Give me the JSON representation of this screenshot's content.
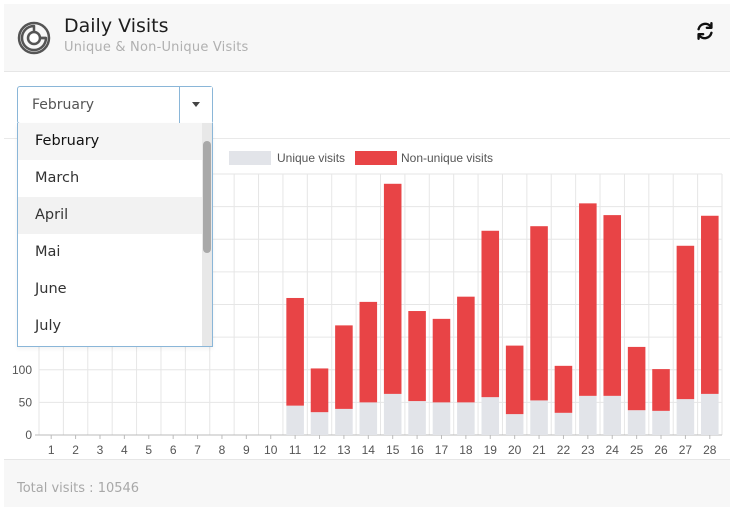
{
  "header": {
    "title": "Daily Visits",
    "subtitle": "Unique & Non-Unique Visits",
    "icon": "pie-chart-icon",
    "refresh_icon": "refresh-icon"
  },
  "month_select": {
    "selected": "February",
    "options": [
      "February",
      "March",
      "April",
      "Mai",
      "June",
      "July"
    ]
  },
  "footer": {
    "total_text": "Total visits : 10546"
  },
  "colors": {
    "unique": "#e2e4e9",
    "non_unique": "#e84446",
    "grid": "#e6e6e6"
  },
  "chart_data": {
    "type": "bar",
    "stacked": true,
    "categories": [
      "1",
      "2",
      "3",
      "4",
      "5",
      "6",
      "7",
      "8",
      "9",
      "10",
      "11",
      "12",
      "13",
      "14",
      "15",
      "16",
      "17",
      "18",
      "19",
      "20",
      "21",
      "22",
      "23",
      "24",
      "25",
      "26",
      "27",
      "28"
    ],
    "series": [
      {
        "name": "Unique visits",
        "values": [
          0,
          0,
          0,
          0,
          0,
          0,
          0,
          0,
          0,
          0,
          45,
          35,
          40,
          50,
          63,
          52,
          50,
          50,
          58,
          32,
          53,
          34,
          60,
          60,
          38,
          37,
          55,
          63
        ]
      },
      {
        "name": "Non-unique visits",
        "values": [
          0,
          0,
          0,
          0,
          0,
          0,
          0,
          0,
          0,
          0,
          165,
          67,
          128,
          154,
          322,
          138,
          128,
          162,
          255,
          105,
          267,
          72,
          295,
          277,
          97,
          64,
          235,
          273
        ]
      }
    ],
    "y_ticks": [
      "0",
      "50",
      "100"
    ],
    "ylim": [
      0,
      400
    ],
    "grid": true,
    "legend": "top"
  }
}
